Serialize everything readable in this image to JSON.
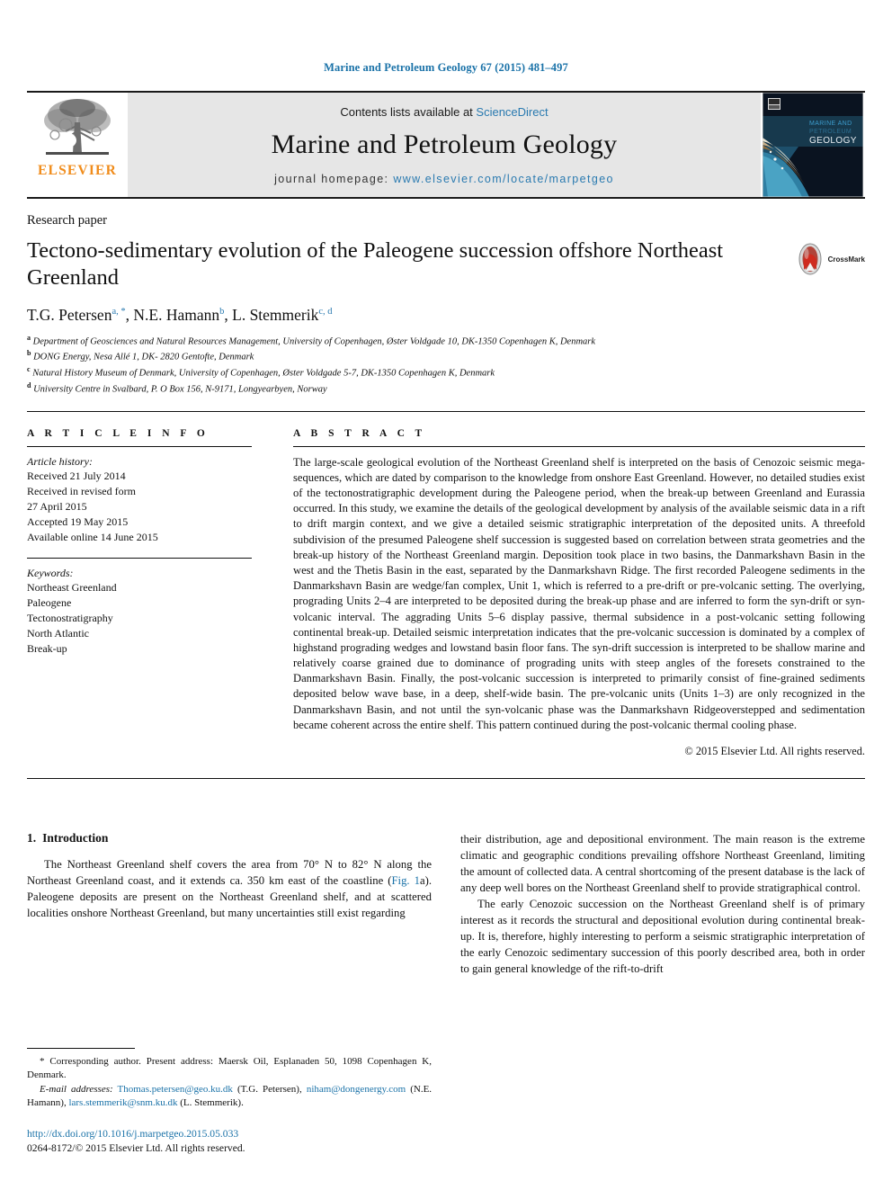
{
  "running_head": "Marine and Petroleum Geology 67 (2015) 481–497",
  "masthead": {
    "publisher_name": "ELSEVIER",
    "contents_prefix": "Contents lists available at ",
    "contents_link": "ScienceDirect",
    "journal_title": "Marine and Petroleum Geology",
    "homepage_prefix": "journal homepage: ",
    "homepage_url": "www.elsevier.com/locate/marpetgeo",
    "cover_caption": "MARINE AND PETROLEUM GEOLOGY"
  },
  "article": {
    "type": "Research paper",
    "title": "Tectono-sedimentary evolution of the Paleogene succession offshore Northeast Greenland",
    "crossmark_label": "CrossMark",
    "authors": [
      {
        "name": "T.G. Petersen",
        "marks": "a, *"
      },
      {
        "name": "N.E. Hamann",
        "marks": "b"
      },
      {
        "name": "L. Stemmerik",
        "marks": "c, d"
      }
    ],
    "affiliations": [
      {
        "mark": "a",
        "text": "Department of Geosciences and Natural Resources Management, University of Copenhagen, Øster Voldgade 10, DK-1350 Copenhagen K, Denmark"
      },
      {
        "mark": "b",
        "text": "DONG Energy, Nesa Allé 1, DK- 2820 Gentofte, Denmark"
      },
      {
        "mark": "c",
        "text": "Natural History Museum of Denmark, University of Copenhagen, Øster Voldgade 5-7, DK-1350 Copenhagen K, Denmark"
      },
      {
        "mark": "d",
        "text": "University Centre in Svalbard, P. O Box 156, N-9171, Longyearbyen, Norway"
      }
    ]
  },
  "article_info": {
    "heading": "A R T I C L E   I N F O",
    "history_label": "Article history:",
    "history": [
      "Received 21 July 2014",
      "Received in revised form",
      "27 April 2015",
      "Accepted 19 May 2015",
      "Available online 14 June 2015"
    ],
    "keywords_label": "Keywords:",
    "keywords": [
      "Northeast Greenland",
      "Paleogene",
      "Tectonostratigraphy",
      "North Atlantic",
      "Break-up"
    ]
  },
  "abstract": {
    "heading": "A B S T R A C T",
    "text": "The large-scale geological evolution of the Northeast Greenland shelf is interpreted on the basis of Cenozoic seismic mega-sequences, which are dated by comparison to the knowledge from onshore East Greenland. However, no detailed studies exist of the tectonostratigraphic development during the Paleogene period, when the break-up between Greenland and Eurassia occurred. In this study, we examine the details of the geological development by analysis of the available seismic data in a rift to drift margin context, and we give a detailed seismic stratigraphic interpretation of the deposited units. A threefold subdivision of the presumed Paleogene shelf succession is suggested based on correlation between strata geometries and the break-up history of the Northeast Greenland margin. Deposition took place in two basins, the Danmarkshavn Basin in the west and the Thetis Basin in the east, separated by the Danmarkshavn Ridge. The first recorded Paleogene sediments in the Danmarkshavn Basin are wedge/fan complex, Unit 1, which is referred to a pre-drift or pre-volcanic setting. The overlying, prograding Units 2–4 are interpreted to be deposited during the break-up phase and are inferred to form the syn-drift or syn-volcanic interval. The aggrading Units 5–6 display passive, thermal subsidence in a post-volcanic setting following continental break-up. Detailed seismic interpretation indicates that the pre-volcanic succession is dominated by a complex of highstand prograding wedges and lowstand basin floor fans. The syn-drift succession is interpreted to be shallow marine and relatively coarse grained due to dominance of prograding units with steep angles of the foresets constrained to the Danmarkshavn Basin. Finally, the post-volcanic succession is interpreted to primarily consist of fine-grained sediments deposited below wave base, in a deep, shelf-wide basin. The pre-volcanic units (Units 1–3) are only recognized in the Danmarkshavn Basin, and not until the syn-volcanic phase was the Danmarkshavn Ridgeoverstepped and sedimentation became coherent across the entire shelf. This pattern continued during the post-volcanic thermal cooling phase.",
    "copyright": "© 2015 Elsevier Ltd. All rights reserved."
  },
  "introduction": {
    "number": "1.",
    "title": "Introduction",
    "para1_before_link": "The Northeast Greenland shelf covers the area from 70° N to 82° N along the Northeast Greenland coast, and it extends ca. 350 km east of the coastline (",
    "para1_link": "Fig. 1",
    "para1_after_link": "a). Paleogene deposits are present on the Northeast Greenland shelf, and at scattered localities onshore Northeast Greenland, but many uncertainties still exist regarding their distribution, age and depositional environment. The main reason is the extreme climatic and geographic conditions prevailing offshore Northeast Greenland, limiting the amount of collected data. A central shortcoming of the present database is the lack of any deep well bores on the Northeast Greenland shelf to provide stratigraphical control.",
    "para2": "The early Cenozoic succession on the Northeast Greenland shelf is of primary interest as it records the structural and depositional evolution during continental break-up. It is, therefore, highly interesting to perform a seismic stratigraphic interpretation of the early Cenozoic sedimentary succession of this poorly described area, both in order to gain general knowledge of the rift-to-drift"
  },
  "footnotes": {
    "corresponding": "* Corresponding author. Present address: Maersk Oil, Esplanaden 50, 1098 Copenhagen K, Denmark.",
    "email_label": "E-mail addresses:",
    "emails": [
      {
        "address": "Thomas.petersen@geo.ku.dk",
        "owner": "(T.G. Petersen)"
      },
      {
        "address": "niham@dongenergy.com",
        "owner": "(N.E. Hamann)"
      },
      {
        "address": "lars.stemmerik@snm.ku.dk",
        "owner": "(L. Stemmerik)"
      }
    ],
    "doi": "http://dx.doi.org/10.1016/j.marpetgeo.2015.05.033",
    "issn_line": "0264-8172/© 2015 Elsevier Ltd. All rights reserved."
  },
  "colors": {
    "link_blue": "#1a72a8",
    "elsevier_orange": "#f08c1b",
    "banner_grey": "#e6e6e6"
  }
}
